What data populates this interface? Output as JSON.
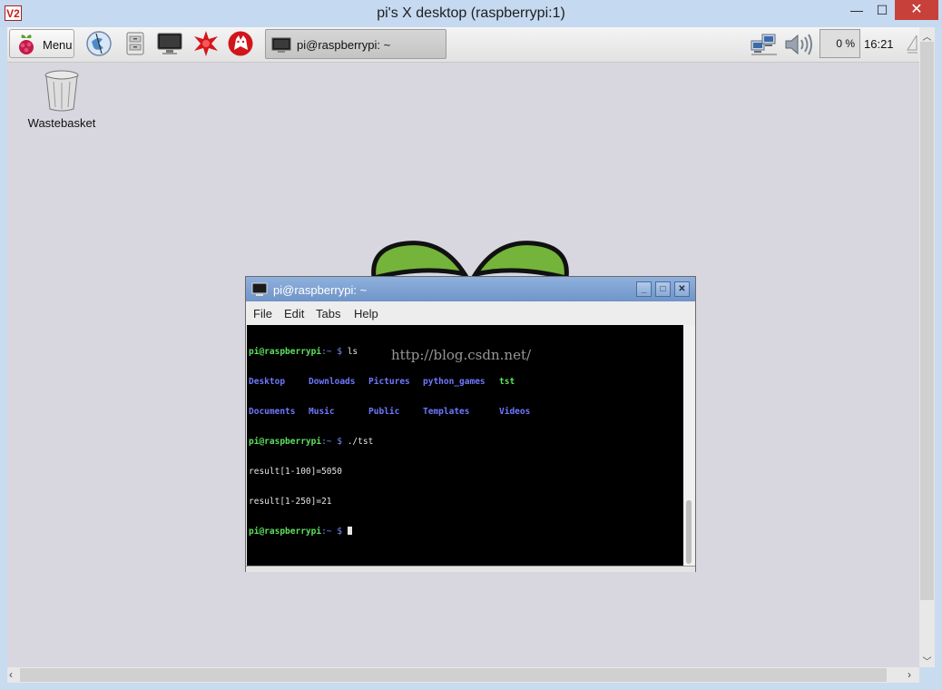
{
  "vnc_window": {
    "app_icon_text": "V2",
    "title": "pi's X desktop (raspberrypi:1)",
    "minimize_glyph": "—",
    "maximize_glyph": "☐",
    "close_glyph": "✕"
  },
  "panel": {
    "menu_label": "Menu",
    "launchers": [
      "web-browser-icon",
      "file-manager-icon",
      "terminal-icon",
      "mathematica-icon",
      "wolfram-icon"
    ],
    "task_button_label": "pi@raspberrypi: ~",
    "cpu_usage": "0 %",
    "clock": "16:21"
  },
  "desktop": {
    "wastebasket_label": "Wastebasket"
  },
  "terminal": {
    "title": "pi@raspberrypi: ~",
    "menu": [
      "File",
      "Edit",
      "Tabs",
      "Help"
    ],
    "prompt_user": "pi@raspberrypi",
    "prompt_path": ":~ $ ",
    "cmd1": "ls",
    "ls_row1": [
      "Desktop",
      "Downloads",
      "Pictures",
      "python_games",
      "tst"
    ],
    "ls_row2": [
      "Documents",
      "Music",
      "Public",
      "Templates",
      "Videos"
    ],
    "cmd2": "./tst",
    "output1": "result[1-100]=5050",
    "output2": "result[1-250]=21"
  },
  "watermark": "http://blog.csdn.net/",
  "colors": {
    "prompt_green": "#5ee05e",
    "dir_blue": "#6f78ff",
    "close_red": "#c7403a",
    "titlebar_blue": "#7fa3d4"
  }
}
